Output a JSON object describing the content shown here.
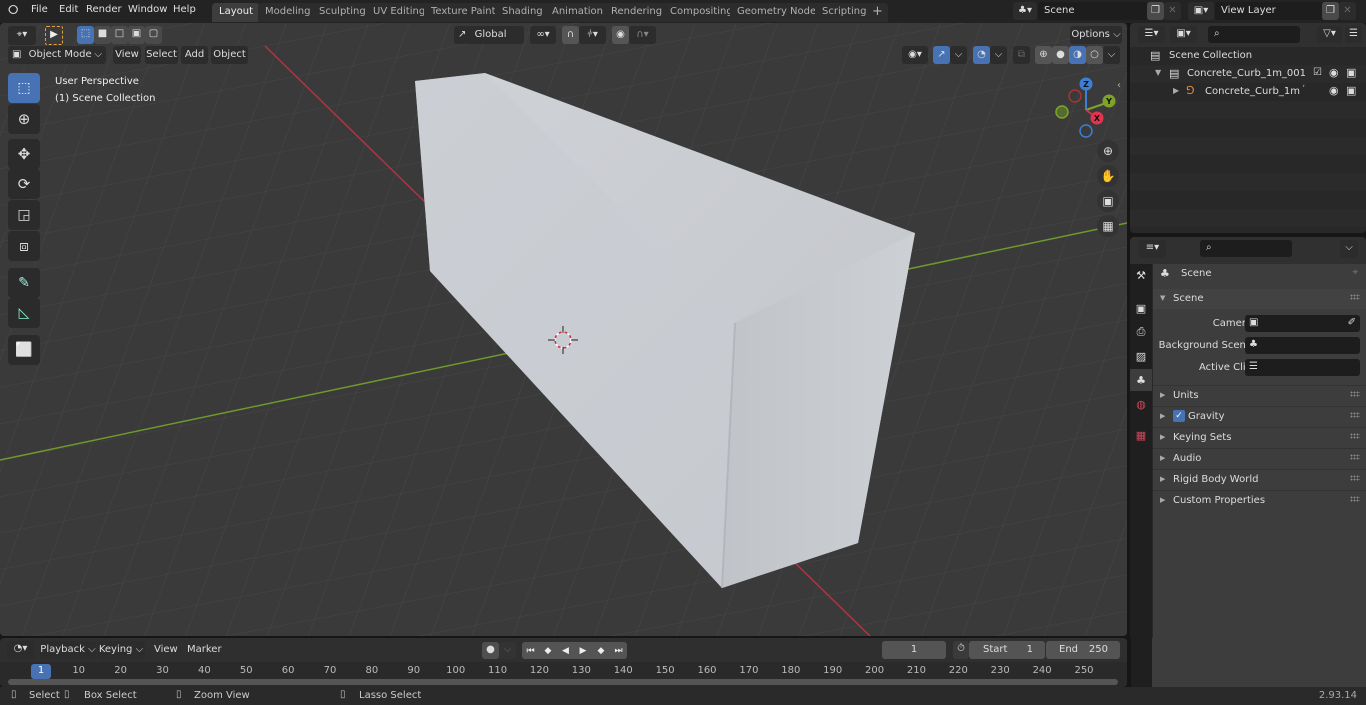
{
  "app": {
    "version": "2.93.14"
  },
  "topbar": {
    "menu": [
      "File",
      "Edit",
      "Render",
      "Window",
      "Help"
    ],
    "workspaces": [
      "Layout",
      "Modeling",
      "Sculpting",
      "UV Editing",
      "Texture Paint",
      "Shading",
      "Animation",
      "Rendering",
      "Compositing",
      "Geometry Nodes",
      "Scripting"
    ],
    "active_workspace": "Layout",
    "add_workspace": "+",
    "scene_name": "Scene",
    "view_layer_name": "View Layer"
  },
  "viewport": {
    "mode": "Object Mode",
    "menus": [
      "View",
      "Select",
      "Add",
      "Object"
    ],
    "transform_orientation": "Global",
    "options_label": "Options",
    "overlay_text": {
      "view_name": "User Perspective",
      "collection": "(1) Scene Collection"
    },
    "gizmo_axes": {
      "x": "X",
      "y": "Y",
      "z": "Z"
    },
    "tools": [
      "select-box",
      "cursor",
      "move",
      "rotate",
      "scale",
      "transform",
      "annotate",
      "measure",
      "add-cube"
    ],
    "colors": {
      "axis_x": "#c33a48",
      "axis_y": "#7ea32b",
      "axis_z": "#3d7fd6",
      "accent": "#4772b3"
    }
  },
  "outliner": {
    "search_placeholder": "",
    "root": "Scene Collection",
    "items": [
      {
        "name": "Concrete_Curb_1m_001",
        "type": "collection",
        "checked": true
      },
      {
        "name": "Concrete_Curb_1m",
        "type": "armature"
      }
    ]
  },
  "properties": {
    "search_placeholder": "",
    "context": "Scene",
    "panel_title": "Scene",
    "fields": [
      {
        "label": "Camera",
        "value": ""
      },
      {
        "label": "Background Scene",
        "value": ""
      },
      {
        "label": "Active Clip",
        "value": ""
      }
    ],
    "subpanels": [
      "Units",
      "Gravity",
      "Keying Sets",
      "Audio",
      "Rigid Body World",
      "Custom Properties"
    ],
    "gravity_enabled": true
  },
  "timeline": {
    "menus": [
      "Playback",
      "Keying",
      "View",
      "Marker"
    ],
    "current_frame": "1",
    "start_label": "Start",
    "start": "1",
    "end_label": "End",
    "end": "250",
    "ticks": [
      "1",
      "10",
      "20",
      "30",
      "40",
      "50",
      "60",
      "70",
      "80",
      "90",
      "100",
      "110",
      "120",
      "130",
      "140",
      "150",
      "160",
      "170",
      "180",
      "190",
      "200",
      "210",
      "220",
      "230",
      "240",
      "250"
    ]
  },
  "statusbar": {
    "hints": [
      "Select",
      "Box Select",
      "Zoom View",
      "Lasso Select"
    ],
    "version": "2.93.14"
  }
}
